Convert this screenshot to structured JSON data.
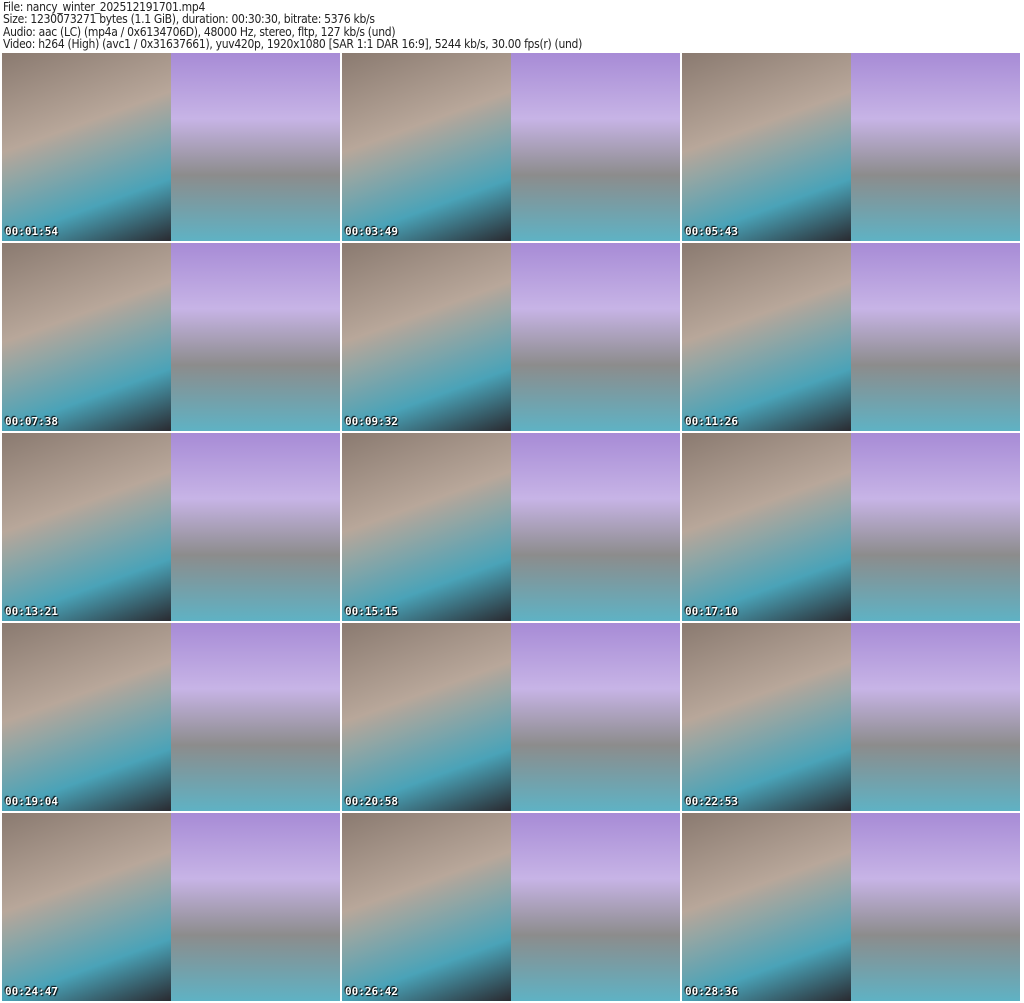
{
  "header": {
    "file": "File: nancy_winter_202512191701.mp4",
    "size": "Size: 1230073271 bytes (1.1 GiB), duration: 00:30:30, bitrate: 5376 kb/s",
    "audio": "Audio: aac (LC) (mp4a / 0x6134706D), 48000 Hz, stereo, fltp, 127 kb/s (und)",
    "video": "Video: h264 (High) (avc1 / 0x31637661), yuv420p, 1920x1080 [SAR 1:1 DAR 16:9], 5244 kb/s, 30.00 fps(r) (und)"
  },
  "thumbnails": [
    "00:01:54",
    "00:03:49",
    "00:05:43",
    "00:07:38",
    "00:09:32",
    "00:11:26",
    "00:13:21",
    "00:15:15",
    "00:17:10",
    "00:19:04",
    "00:20:58",
    "00:22:53",
    "00:24:47",
    "00:26:42",
    "00:28:36"
  ]
}
